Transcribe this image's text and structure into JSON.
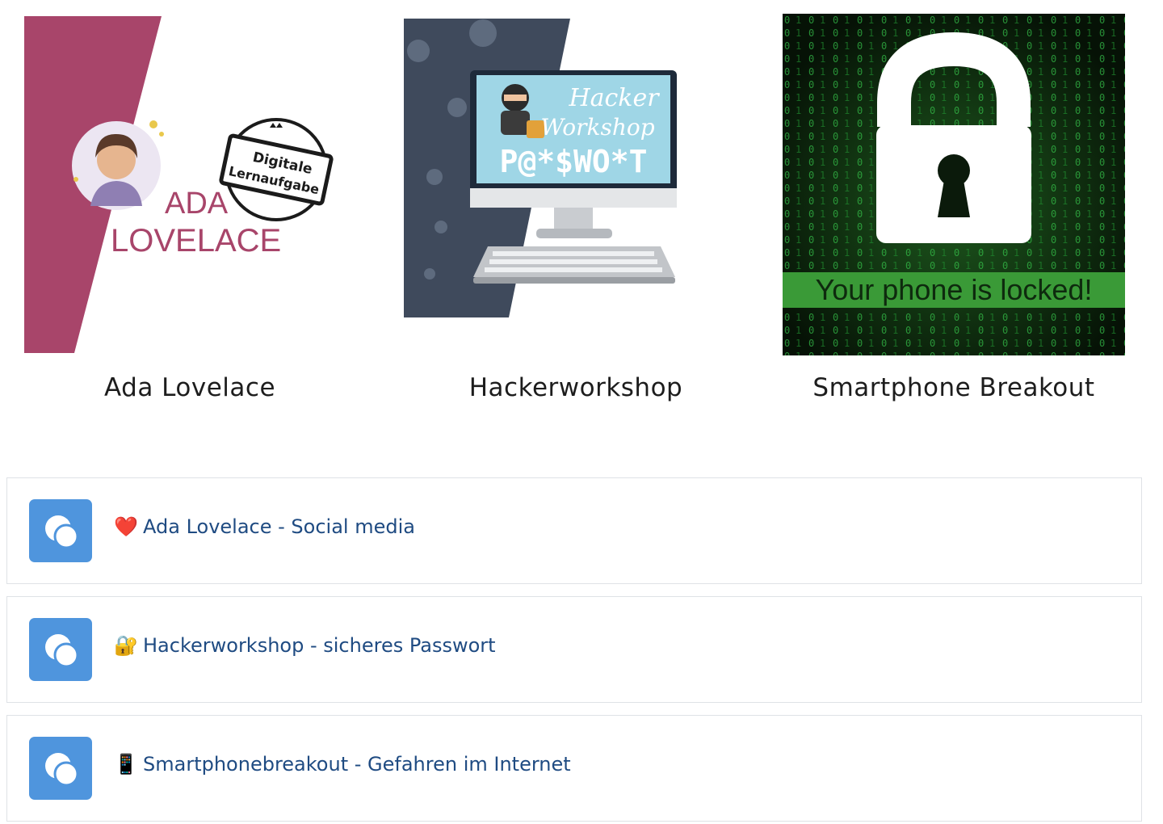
{
  "cards": [
    {
      "title": "Ada Lovelace",
      "image": {
        "name_line1": "ADA",
        "name_line2": "LOVELACE",
        "stamp_line1": "Digitale",
        "stamp_line2": "Lernaufgabe",
        "accent": "#a8456a"
      }
    },
    {
      "title": "Hackerworkshop",
      "image": {
        "script_line1": "Hacker",
        "script_line2": "Workshop",
        "password": "P@*$WO*T",
        "panel_color": "#3f4a5c",
        "screen_color": "#9fd6e6"
      }
    },
    {
      "title": "Smartphone Breakout",
      "image": {
        "banner": "Your phone is locked!",
        "bg_color": "#0b1a0b",
        "banner_color": "#3a9a37"
      }
    }
  ],
  "activities": [
    {
      "emoji": "❤️",
      "label": "Ada Lovelace - Social media",
      "icon": "h5p-activity-icon"
    },
    {
      "emoji": "🔐",
      "label": "Hackerworkshop - sicheres Passwort",
      "icon": "h5p-activity-icon"
    },
    {
      "emoji": "📱",
      "label": "Smartphonebreakout - Gefahren im Internet",
      "icon": "h5p-activity-icon"
    }
  ]
}
